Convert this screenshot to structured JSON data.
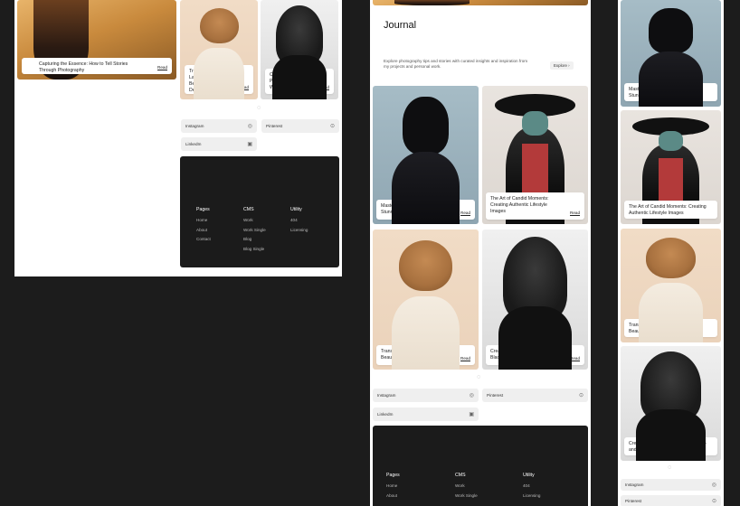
{
  "left": {
    "featured_caption": "Capturing the Essence: How to Tell Stories Through Photography",
    "read_label": "Read",
    "cards": [
      {
        "title": "Transforming Landscapes: Finding Beauty in Nature's Details"
      },
      {
        "title": "Creating Impact: The Power of Black-and-White Portraits"
      }
    ],
    "social": [
      {
        "label": "Instagram"
      },
      {
        "label": "Pinterest"
      },
      {
        "label": "LinkedIn"
      }
    ],
    "footer": {
      "pages_title": "Pages",
      "pages": [
        "Home",
        "About",
        "Contact"
      ],
      "cms_title": "CMS",
      "cms": [
        "Work",
        "Work Single",
        "Blog",
        "Blog Single"
      ],
      "utility_title": "Utility",
      "utility": [
        "404",
        "Licensing"
      ]
    }
  },
  "middle": {
    "journal_title": "Journal",
    "intro": "Explore photography tips and stories with curated insights and inspiration from my projects and personal work.",
    "explore_label": "Explore",
    "cards": [
      {
        "title": "Mastering Light: Techniques for Stunning Urban Photography"
      },
      {
        "title": "The Art of Candid Moments: Creating Authentic Lifestyle Images"
      },
      {
        "title": "Transforming Landscapes: Finding Beauty in Nature's Details"
      },
      {
        "title": "Creating Impact: The Power of Black-and-White Portraits"
      }
    ],
    "read_label": "Read",
    "social": [
      {
        "label": "Instagram"
      },
      {
        "label": "Pinterest"
      },
      {
        "label": "LinkedIn"
      }
    ],
    "footer": {
      "pages_title": "Pages",
      "pages": [
        "Home",
        "About"
      ],
      "cms_title": "CMS",
      "cms": [
        "Work",
        "Work Single"
      ],
      "utility_title": "Utility",
      "utility": [
        "404",
        "Licensing"
      ]
    }
  },
  "right": {
    "cards": [
      {
        "title": "Mastering Light: Techniques for Stunning Urban Photography"
      },
      {
        "title": "The Art of Candid Moments: Creating Authentic Lifestyle Images"
      },
      {
        "title": "Transforming Landscapes: Finding Beauty in Nature's Details"
      },
      {
        "title": "Creating Impact: The Power of Black-and-White Portraits"
      }
    ],
    "social": [
      {
        "label": "Instagram"
      },
      {
        "label": "Pinterest"
      }
    ]
  },
  "icons": {
    "instagram": "instagram-icon",
    "pinterest": "pinterest-icon",
    "linkedin": "linkedin-icon",
    "loading": "loading-icon",
    "explore_arrow": "arrow-right-icon"
  },
  "colors": {
    "background": "#1c1c1c",
    "panel": "#ffffff",
    "footer": "#1b1b1b",
    "social_button": "#efefef"
  }
}
